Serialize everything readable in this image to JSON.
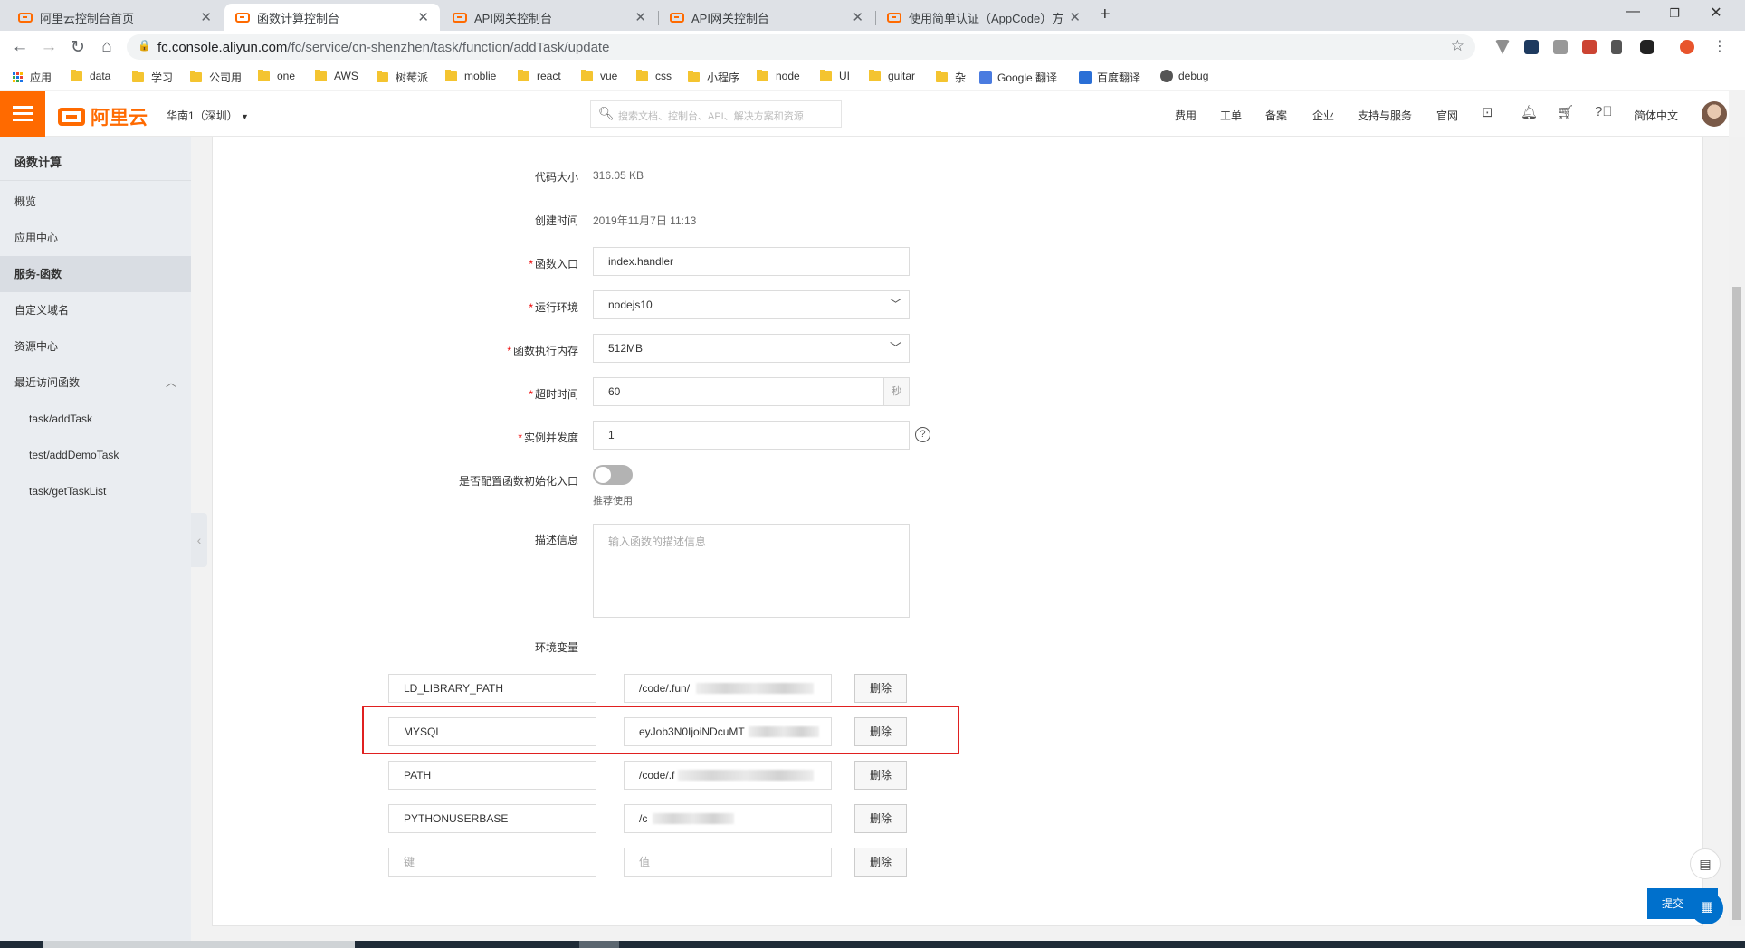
{
  "browser": {
    "tabs": [
      {
        "title": "阿里云控制台首页",
        "active": false
      },
      {
        "title": "函数计算控制台",
        "active": true
      },
      {
        "title": "API网关控制台",
        "active": false
      },
      {
        "title": "API网关控制台",
        "active": false
      },
      {
        "title": "使用简单认证（AppCode）方式",
        "active": false
      }
    ],
    "new_tab": "+",
    "url_host": "fc.console.aliyun.com",
    "url_path": "/fc/service/cn-shenzhen/task/function/addTask/update",
    "bookmarks": [
      "应用",
      "data",
      "学习",
      "公司用",
      "one",
      "AWS",
      "树莓派",
      "moblie",
      "react",
      "vue",
      "css",
      "小程序",
      "node",
      "UI",
      "guitar",
      "杂",
      "Google 翻译",
      "百度翻译",
      "debug"
    ]
  },
  "header": {
    "logo": "阿里云",
    "region": "华南1（深圳）",
    "search_placeholder": "搜索文档、控制台、API、解决方案和资源",
    "nav": [
      "费用",
      "工单",
      "备案",
      "企业",
      "支持与服务",
      "官网"
    ],
    "language": "简体中文"
  },
  "sidebar": {
    "title": "函数计算",
    "items": [
      "概览",
      "应用中心",
      "服务-函数",
      "自定义域名",
      "资源中心",
      "最近访问函数"
    ],
    "recent": [
      "task/addTask",
      "test/addDemoTask",
      "task/getTaskList"
    ]
  },
  "form": {
    "code_size_label": "代码大小",
    "code_size": "316.05 KB",
    "created_label": "创建时间",
    "created": "2019年11月7日 11:13",
    "handler_label": "函数入口",
    "handler": "index.handler",
    "runtime_label": "运行环境",
    "runtime": "nodejs10",
    "memory_label": "函数执行内存",
    "memory": "512MB",
    "timeout_label": "超时时间",
    "timeout": "60",
    "timeout_unit": "秒",
    "concurrency_label": "实例并发度",
    "concurrency": "1",
    "init_label": "是否配置函数初始化入口",
    "init_hint": "推荐使用",
    "desc_label": "描述信息",
    "desc_placeholder": "输入函数的描述信息",
    "env_label": "环境变量",
    "env": [
      {
        "key": "LD_LIBRARY_PATH",
        "value": "/code/.fun/"
      },
      {
        "key": "MYSQL",
        "value": "eyJob3N0IjoiNDcuMT"
      },
      {
        "key": "PATH",
        "value": "/code/.f"
      },
      {
        "key": "PYTHONUSERBASE",
        "value": "/c"
      }
    ],
    "env_key_placeholder": "键",
    "env_value_placeholder": "值",
    "delete_label": "删除",
    "submit_label": "提交"
  }
}
